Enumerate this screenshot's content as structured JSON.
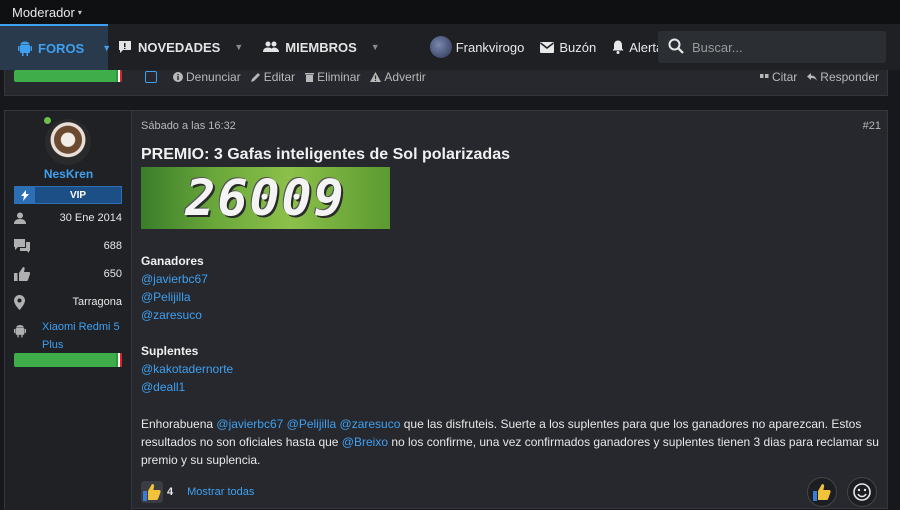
{
  "topbar": {
    "moderator_label": "Moderador",
    "caret": "▾"
  },
  "nav": {
    "tabs": [
      {
        "label": "FOROS",
        "active": true
      },
      {
        "label": "NOVEDADES",
        "active": false
      },
      {
        "label": "MIEMBROS",
        "active": false
      }
    ],
    "user_label": "Frankvirogo",
    "inbox_label": "Buzón",
    "alerts_label": "Alertas",
    "search_placeholder": "Buscar..."
  },
  "prev_post_actions": {
    "left": [
      "Denunciar",
      "Editar",
      "Eliminar",
      "Advertir"
    ],
    "right": [
      "Citar",
      "Responder"
    ]
  },
  "user": {
    "name": "NesKren",
    "badge": "VIP",
    "joined": "30 Ene 2014",
    "messages": "688",
    "reactions": "650",
    "location": "Tarragona",
    "device": "Xiaomi Redmi 5 Plus"
  },
  "post": {
    "date": "Sábado a las 16:32",
    "number": "#21",
    "title": "PREMIO: 3 Gafas inteligentes de Sol polarizadas",
    "captcha_text": "26009",
    "winners_heading": "Ganadores",
    "winners": [
      "@javierbc67",
      "@Pelijilla",
      "@zaresuco"
    ],
    "alternates_heading": "Suplentes",
    "alternates": [
      "@kakotadernorte",
      "@deall1"
    ],
    "body": {
      "p1": "Enhorabuena ",
      "m1": "@javierbc67",
      "s1": " ",
      "m2": "@Pelijilla",
      "s2": " ",
      "m3": "@zaresuco",
      "p2": " que las disfruteis. Suerte a los suplentes para que los ganadores no aparezcan. Estos resultados no son oficiales hasta que ",
      "m4": "@Breixo",
      "p3": " no los confirme, una vez confirmados ganadores y suplentes tienen 3 dias para reclamar su premio y su suplencia."
    },
    "reaction_count": "4",
    "show_all_label": "Mostrar todas"
  },
  "colors": {
    "accent": "#3fa0f0",
    "online": "#6bc04a",
    "bar": "#3fae4a"
  }
}
